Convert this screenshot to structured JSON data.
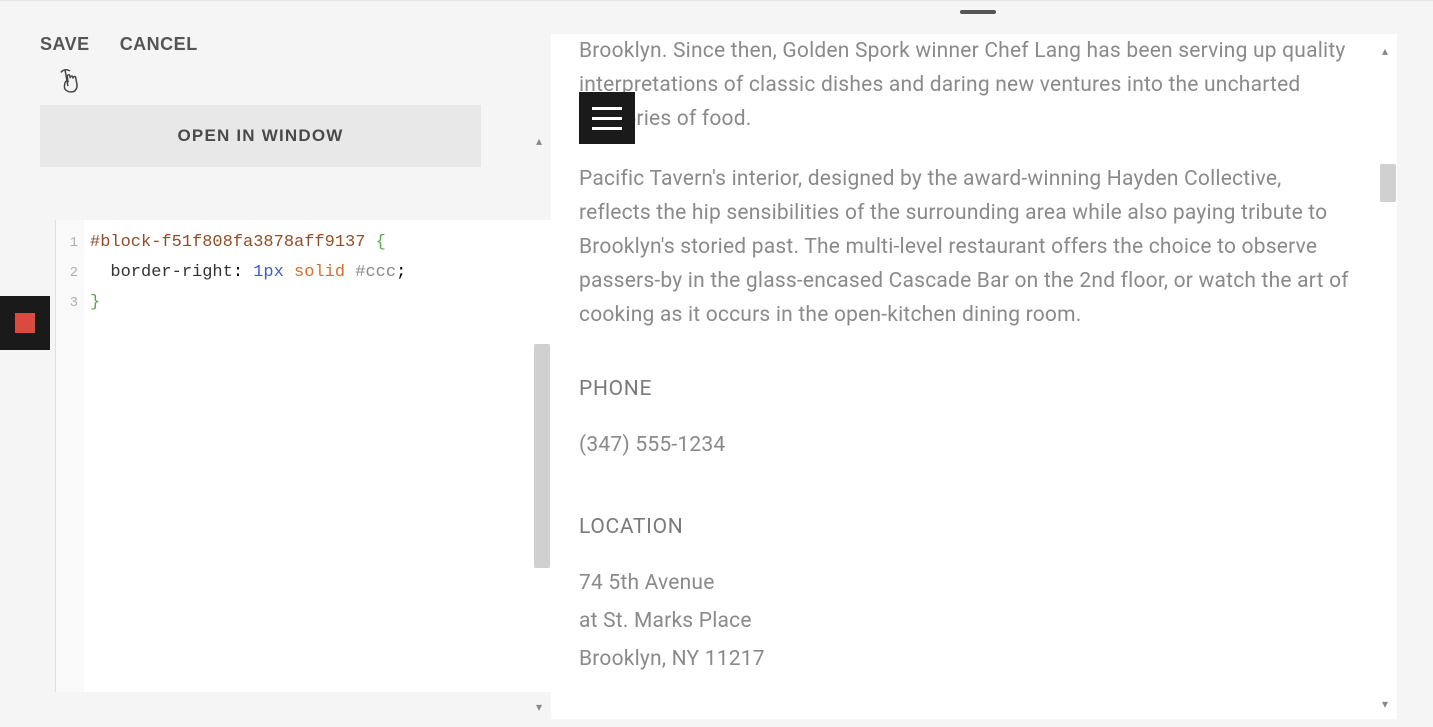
{
  "actions": {
    "save": "SAVE",
    "cancel": "CANCEL"
  },
  "open_window": "OPEN IN WINDOW",
  "code": {
    "line_numbers": [
      "1",
      "2",
      "3"
    ],
    "selector": "#block-f51f808fa3878aff9137",
    "brace_open": "{",
    "property": "border-right",
    "value_px": "1px",
    "value_solid": "solid",
    "value_color": "#ccc",
    "semicolon": ";",
    "brace_close": "}"
  },
  "preview": {
    "para1": "Brooklyn. Since then, Golden Spork winner Chef Lang has been serving up quality interpretations of classic dishes and daring new ventures into the uncharted territories of food.",
    "para2": "Pacific Tavern's interior, designed by the award-winning Hayden Collective, reflects the hip sensibilities of the surrounding area while also paying tribute to Brooklyn's storied past. The multi-level restaurant offers the choice to observe passers-by in the glass-encased Cascade Bar on the 2nd floor, or watch the art of cooking as it occurs in the open-kitchen dining room.",
    "phone_heading": "PHONE",
    "phone_value": "(347) 555-1234",
    "location_heading": "LOCATION",
    "location_line1": "74 5th Avenue",
    "location_line2": "at St. Marks Place",
    "location_line3": "Brooklyn, NY 11217"
  }
}
